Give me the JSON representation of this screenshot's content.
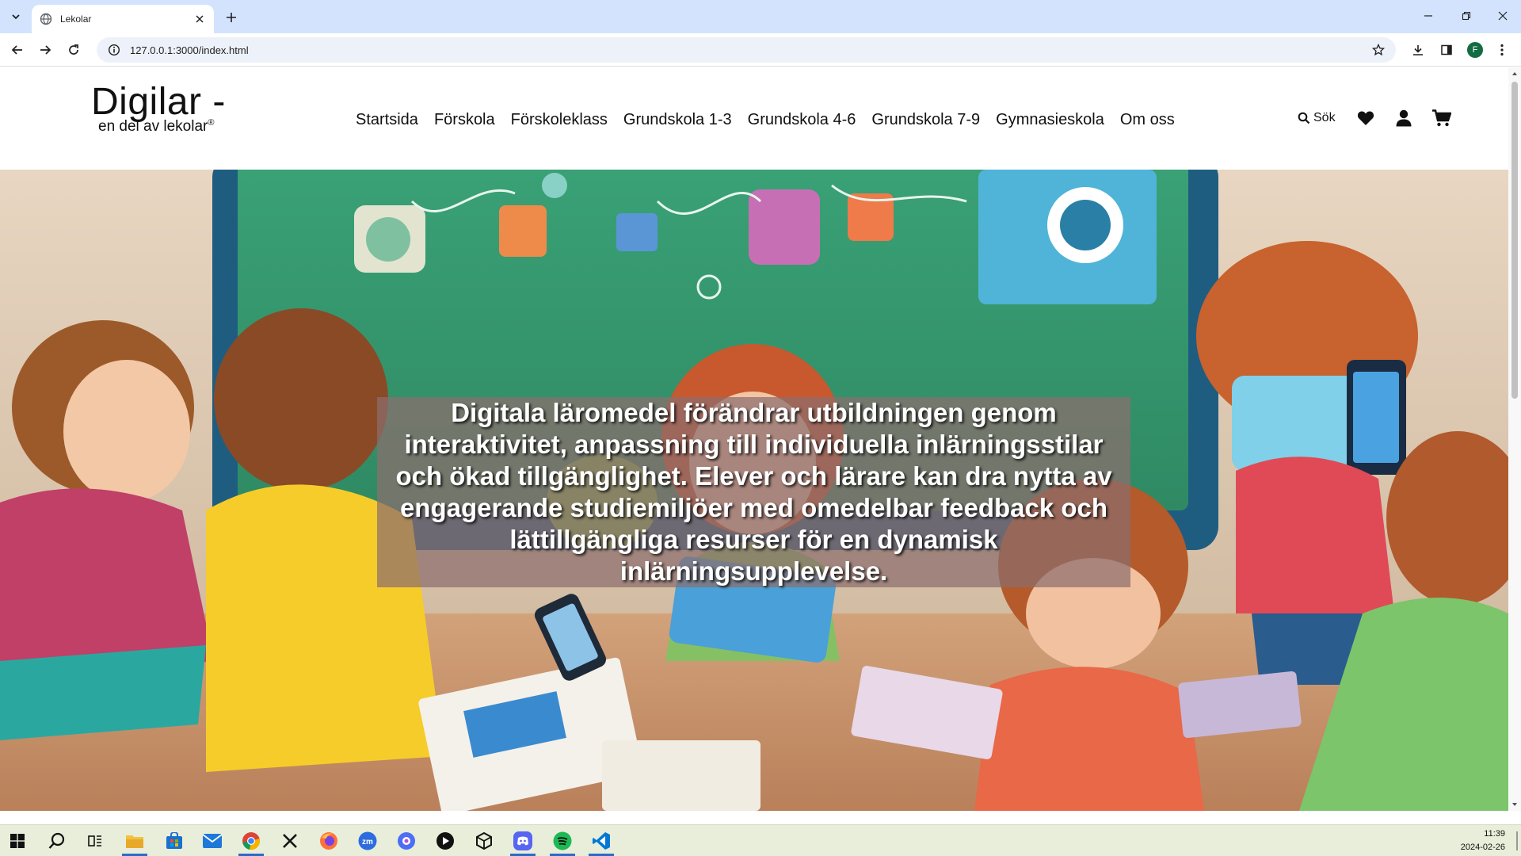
{
  "browser": {
    "tab_title": "Lekolar",
    "url": "127.0.0.1:3000/index.html",
    "profile_initial": "F"
  },
  "site": {
    "logo_main": "Digilar -",
    "logo_sub": "en del av lekolar",
    "logo_reg": "®",
    "nav": [
      {
        "label": "Startsida"
      },
      {
        "label": "Förskola"
      },
      {
        "label": "Förskoleklass"
      },
      {
        "label": "Grundskola 1-3"
      },
      {
        "label": "Grundskola 4-6"
      },
      {
        "label": "Grundskola 7-9"
      },
      {
        "label": "Gymnasieskola"
      },
      {
        "label": "Om oss"
      }
    ],
    "search_label": "Sök",
    "hero_text": "Digitala läromedel förändrar utbildningen genom interaktivitet, anpassning till individuella inlärningsstilar och ökad tillgänglighet. Elever och lärare kan dra nytta av engagerande studiemiljöer med omedelbar feedback och lättillgängliga resurser för en dynamisk inlärningsupplevelse."
  },
  "taskbar": {
    "time": "11:39",
    "date": "2024-02-26",
    "apps": [
      "windows-start",
      "search",
      "task-view",
      "file-explorer",
      "store",
      "mail",
      "chrome",
      "x",
      "firefox",
      "zoom",
      "media",
      "player",
      "unity",
      "discord",
      "spotify",
      "vscode"
    ]
  },
  "colors": {
    "tabbar_bg": "#d3e3fd",
    "omnibox_bg": "#edf2fa",
    "taskbar_bg": "#e8eed9",
    "caption_bg": "#8c6e6e"
  }
}
